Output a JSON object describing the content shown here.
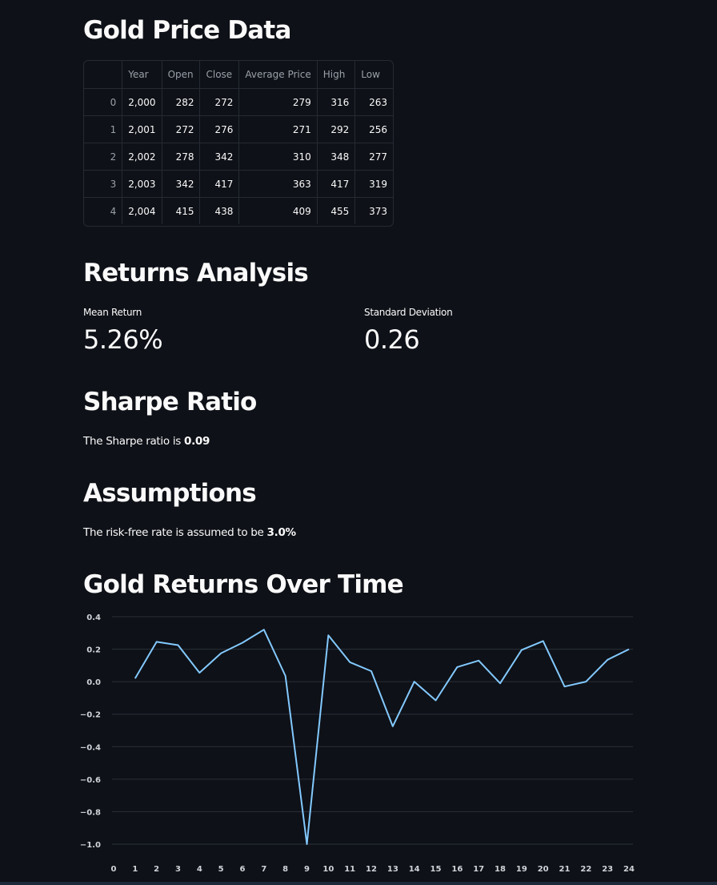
{
  "sections": {
    "gold_title": "Gold Price Data",
    "returns_title": "Returns Analysis",
    "sharpe_title": "Sharpe Ratio",
    "assumptions_title": "Assumptions",
    "chart_title": "Gold Returns Over Time"
  },
  "table": {
    "columns": [
      "",
      "Year",
      "Open",
      "Close",
      "Average Price",
      "High",
      "Low"
    ],
    "rows": [
      [
        "0",
        "2,000",
        "282",
        "272",
        "279",
        "316",
        "263"
      ],
      [
        "1",
        "2,001",
        "272",
        "276",
        "271",
        "292",
        "256"
      ],
      [
        "2",
        "2,002",
        "278",
        "342",
        "310",
        "348",
        "277"
      ],
      [
        "3",
        "2,003",
        "342",
        "417",
        "363",
        "417",
        "319"
      ],
      [
        "4",
        "2,004",
        "415",
        "438",
        "409",
        "455",
        "373"
      ]
    ]
  },
  "metrics": {
    "mean_label": "Mean Return",
    "mean_value": "5.26%",
    "std_label": "Standard Deviation",
    "std_value": "0.26"
  },
  "sharpe": {
    "prefix": "The Sharpe ratio is ",
    "value": "0.09"
  },
  "assumptions": {
    "prefix": "The risk-free rate is assumed to be ",
    "value": "3.0%"
  },
  "colors": {
    "background": "#0e1117",
    "line": "#83c9ff",
    "grid": "#2b2f38"
  },
  "chart_data": {
    "type": "line",
    "x": [
      1,
      2,
      3,
      4,
      5,
      6,
      7,
      8,
      9,
      10,
      11,
      12,
      13,
      14,
      15,
      16,
      17,
      18,
      19,
      20,
      21,
      22,
      23,
      24
    ],
    "values": [
      0.02,
      0.245,
      0.225,
      0.055,
      0.175,
      0.24,
      0.32,
      0.035,
      -1.0,
      0.285,
      0.12,
      0.065,
      -0.275,
      0.0,
      -0.115,
      0.09,
      0.13,
      -0.01,
      0.195,
      0.25,
      -0.03,
      0.0,
      0.135,
      0.2
    ],
    "xticks": [
      "0",
      "1",
      "2",
      "3",
      "4",
      "5",
      "6",
      "7",
      "8",
      "9",
      "10",
      "11",
      "12",
      "13",
      "14",
      "15",
      "16",
      "17",
      "18",
      "19",
      "20",
      "21",
      "22",
      "23",
      "24"
    ],
    "yticks": [
      "0.4",
      "0.2",
      "0.0",
      "−0.2",
      "−0.4",
      "−0.6",
      "−0.8",
      "−1.0"
    ],
    "ytick_values": [
      0.4,
      0.2,
      0.0,
      -0.2,
      -0.4,
      -0.6,
      -0.8,
      -1.0
    ],
    "xlim": [
      0,
      24
    ],
    "ylim": [
      -1.0,
      0.4
    ],
    "grid": true,
    "title": "",
    "xlabel": "",
    "ylabel": ""
  }
}
